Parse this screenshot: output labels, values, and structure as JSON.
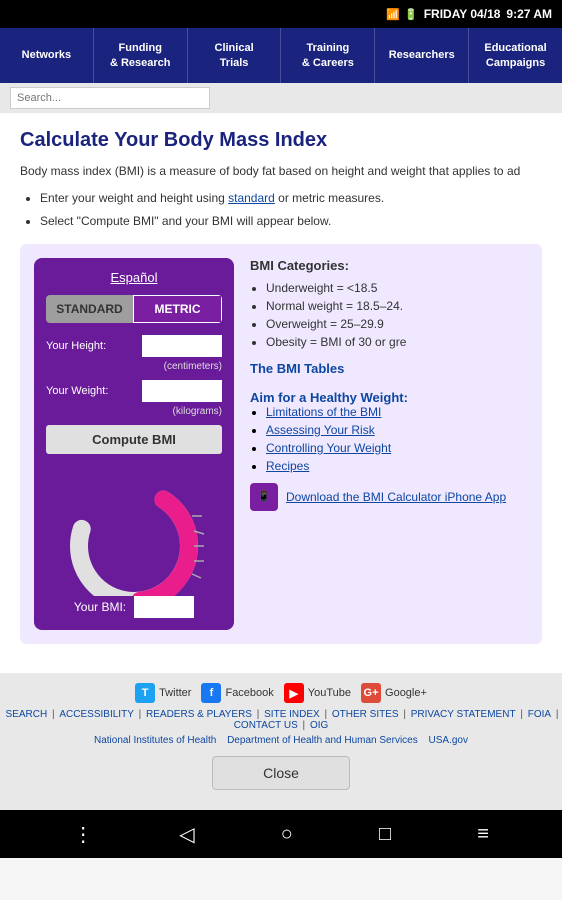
{
  "statusBar": {
    "time": "9:27 AM",
    "date": "FRIDAY 04/18"
  },
  "nav": {
    "items": [
      {
        "id": "networks",
        "label": "Networks"
      },
      {
        "id": "funding",
        "label": "Funding\n& Research"
      },
      {
        "id": "clinical",
        "label": "Clinical\nTrials"
      },
      {
        "id": "training",
        "label": "Training\n& Careers"
      },
      {
        "id": "researchers",
        "label": "Researchers"
      },
      {
        "id": "educational",
        "label": "Educational\nCampaigns"
      }
    ]
  },
  "search": {
    "placeholder": "Search..."
  },
  "main": {
    "title": "Calculate Your Body Mass Index",
    "intro": "Body mass index (BMI) is a measure of body fat based on height and weight that applies to ad",
    "bullets": [
      {
        "text": "Enter your weight and height using ",
        "linkText": "standard",
        "rest": " or metric measures."
      },
      {
        "text": "Select \"Compute BMI\" and your BMI will appear below."
      }
    ]
  },
  "bmiCalculator": {
    "espanol": "Español",
    "tabs": [
      {
        "label": "STANDARD",
        "active": true
      },
      {
        "label": "METRIC",
        "active": false
      }
    ],
    "heightLabel": "Your Height:",
    "heightUnit": "(centimeters)",
    "weightLabel": "Your Weight:",
    "weightUnit": "(kilograms)",
    "computeLabel": "Compute BMI",
    "yourBmiLabel": "Your BMI:",
    "gauge": {
      "emptyColor": "#e0e0e0",
      "fillColor": "#e91e8c"
    }
  },
  "bmiCategories": {
    "title": "BMI Categories:",
    "items": [
      "Underweight = <18.5",
      "Normal weight = 18.5–24.",
      "Overweight = 25–29.9",
      "Obesity = BMI of 30 or gre"
    ],
    "tablesLink": "The BMI Tables",
    "aimLink": "Aim for a Healthy Weight:",
    "aimItems": [
      {
        "label": "Limitations of the BMI"
      },
      {
        "label": "Assessing Your Risk"
      },
      {
        "label": "Controlling Your Weight"
      },
      {
        "label": "Recipes"
      }
    ],
    "downloadLabel": "Download the BMI Calculator iPhone App"
  },
  "social": {
    "items": [
      {
        "name": "Twitter",
        "icon": "T"
      },
      {
        "name": "Facebook",
        "icon": "f"
      },
      {
        "name": "YouTube",
        "icon": "▶"
      },
      {
        "name": "Google+",
        "icon": "G+"
      }
    ]
  },
  "footerLinks": [
    "SEARCH",
    "ACCESSIBILITY",
    "READERS & PLAYERS",
    "SITE INDEX",
    "OTHER SITES",
    "PRIVACY STATEMENT",
    "FOIA",
    "CONTACT US",
    "OIG"
  ],
  "footerOrgs": [
    "National Institutes of Health",
    "Department of Health and Human Services",
    "USA.gov"
  ],
  "closeButton": "Close",
  "android": {
    "buttons": [
      "⋮",
      "◁",
      "○",
      "□",
      "≡"
    ]
  }
}
